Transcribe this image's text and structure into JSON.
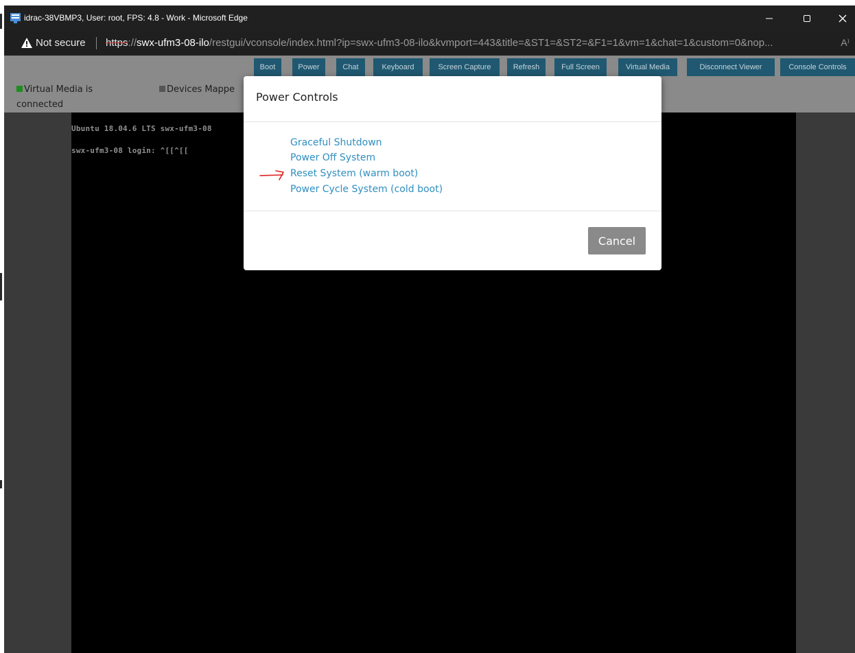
{
  "window": {
    "title": "idrac-38VBMP3, User: root, FPS: 4.8 - Work - Microsoft Edge",
    "controls": [
      "minimize-icon",
      "maximize-icon",
      "close-icon"
    ]
  },
  "address_bar": {
    "security_label": "Not secure",
    "url_scheme": "https",
    "url_scheme_sep": "://",
    "url_host": "swx-ufm3-08-ilo",
    "url_path": "/restgui/vconsole/index.html?ip=swx-ufm3-08-ilo&kvmport=443&title=&ST1=&ST2=&F1=1&vm=1&chat=1&custom=0&nop...",
    "read_aloud_glyph": "A⁾"
  },
  "toolbar": {
    "buttons": [
      "Boot",
      "Power",
      "Chat",
      "Keyboard",
      "Screen Capture",
      "Refresh",
      "Full Screen",
      "Virtual Media",
      "Disconnect Viewer",
      "Console Controls"
    ]
  },
  "status": {
    "virtual_media": "Virtual Media is",
    "virtual_media_cont": "connected",
    "devices_mapped": "Devices Mappe",
    "virtual_media_color": "#1e8c1e",
    "devices_color": "#555555"
  },
  "console": {
    "line1": "Ubuntu 18.04.6 LTS swx-ufm3-08",
    "line2": "swx-ufm3-08 login: ^[[^[["
  },
  "modal": {
    "title": "Power Controls",
    "options": [
      "Graceful Shutdown",
      "Power Off System",
      "Reset System (warm boot)",
      "Power Cycle System (cold boot)"
    ],
    "cancel_label": "Cancel",
    "link_color": "#2f8fc0"
  },
  "annotation": {
    "arrow_color": "#e02020",
    "points_to": "Reset System (warm boot)"
  }
}
